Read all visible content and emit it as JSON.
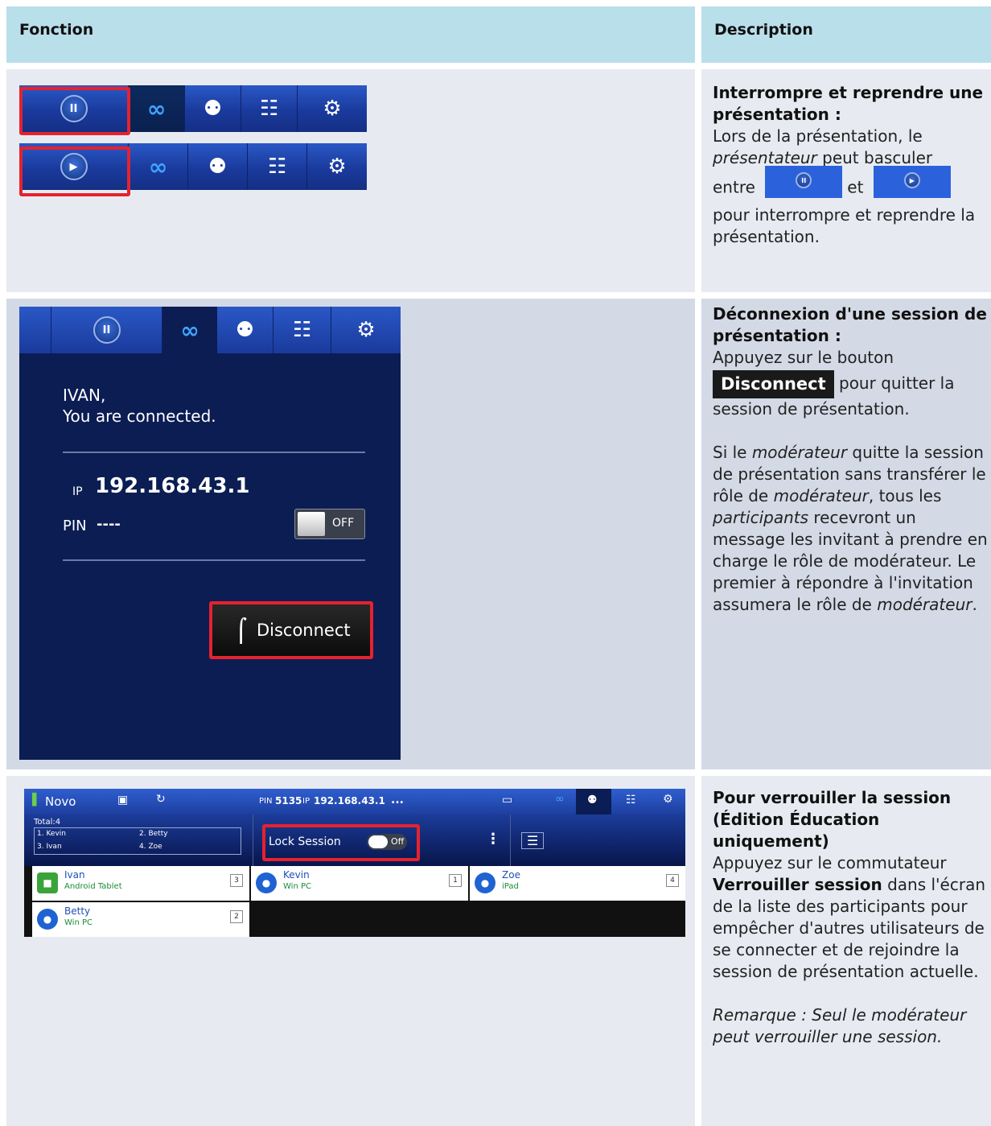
{
  "header": {
    "col1": "Fonction",
    "col2": "Description"
  },
  "row1": {
    "title": "Interrompre et reprendre une présentation :",
    "text_a": "Lors de la présentation, le",
    "text_b_em": "présentateur",
    "text_b": " peut basculer",
    "text_c_a": "entre",
    "text_c_b": "et",
    "text_d": "pour interrompre et reprendre la présentation.",
    "pause_glyph": "II",
    "play_glyph": "▶"
  },
  "row2": {
    "title": "Déconnexion d'une session de présentation :",
    "text_a": "Appuyez sur le bouton",
    "button_label": "Disconnect",
    "text_b": "pour quitter la session de présentation.",
    "para2_a": "Si le ",
    "para2_em1": "modérateur",
    "para2_b": " quitte la session de présentation sans transférer le rôle de ",
    "para2_em2": "modérateur",
    "para2_c": ", tous les ",
    "para2_em3": "participants",
    "para2_d": " recevront un message les invitant à prendre en charge le rôle de modérateur. Le premier à répondre à l'invitation assumera le rôle de ",
    "para2_em4": "modérateur",
    "para2_e": ".",
    "screen": {
      "user": "IVAN,",
      "status": "You are connected.",
      "ip_label": "IP",
      "ip": "192.168.43.1",
      "pin_label": "PIN",
      "pin": "----",
      "toggle": "OFF",
      "disconnect": "Disconnect"
    }
  },
  "row3": {
    "title": "Pour verrouiller la session (Édition Éducation uniquement)",
    "text_a": "Appuyez sur le commutateur ",
    "text_bold": "Verrouiller session",
    "text_b": " dans l'écran de la liste des participants pour empêcher d'autres utilisateurs de se connecter et de rejoindre la session de présentation actuelle.",
    "note": "Remarque : Seul le modérateur peut verrouiller une session.",
    "screen": {
      "app": "Novo",
      "pin_label": "PIN",
      "pin": "5135",
      "ip_label": "IP",
      "ip": "192.168.43.1",
      "more": "...",
      "total": "Total:4",
      "list": [
        "1. Kevin",
        "2. Betty",
        "3. Ivan",
        "4. Zoe"
      ],
      "lock_label": "Lock Session",
      "lock_state": "Off",
      "participants": [
        {
          "name": "Ivan",
          "device": "Android Tablet",
          "page": "3"
        },
        {
          "name": "Kevin",
          "device": "Win PC",
          "page": "1"
        },
        {
          "name": "Zoe",
          "device": "iPad",
          "page": "4"
        },
        {
          "name": "Betty",
          "device": "Win PC",
          "page": "2"
        }
      ]
    }
  },
  "icons": {
    "pause": "pause-icon",
    "play": "play-icon",
    "link": "link-icon",
    "people": "people-icon",
    "grid": "grid-icon",
    "gear": "gear-icon"
  }
}
